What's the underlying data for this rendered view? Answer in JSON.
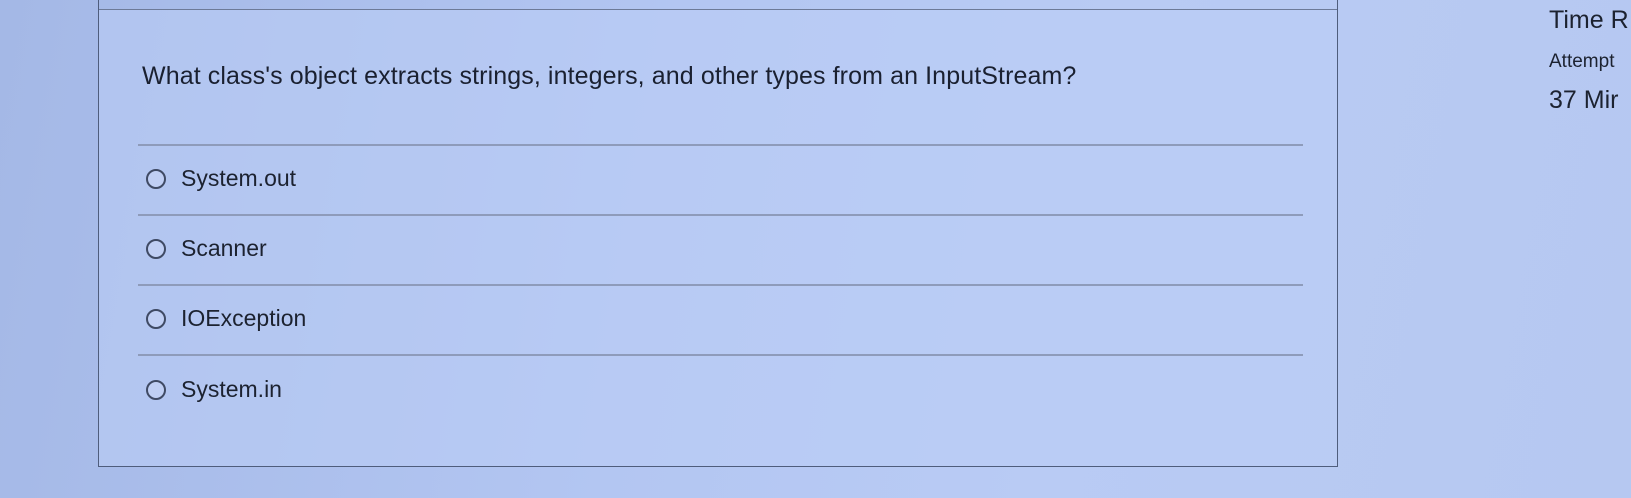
{
  "question": {
    "text": "What class's object extracts strings, integers, and other types from an InputStream?",
    "options": [
      {
        "label": "System.out",
        "selected": false
      },
      {
        "label": "Scanner",
        "selected": false
      },
      {
        "label": "IOException",
        "selected": false
      },
      {
        "label": "System.in",
        "selected": false
      }
    ]
  },
  "sidebar": {
    "timer_title": "Time R",
    "attempt_label": "Attempt",
    "time_remaining": "37 Mir"
  },
  "colors": {
    "background": "#b3c6f2",
    "card_border": "#4f5d7c",
    "text": "#1c2230",
    "divider": "#8e9bba"
  }
}
